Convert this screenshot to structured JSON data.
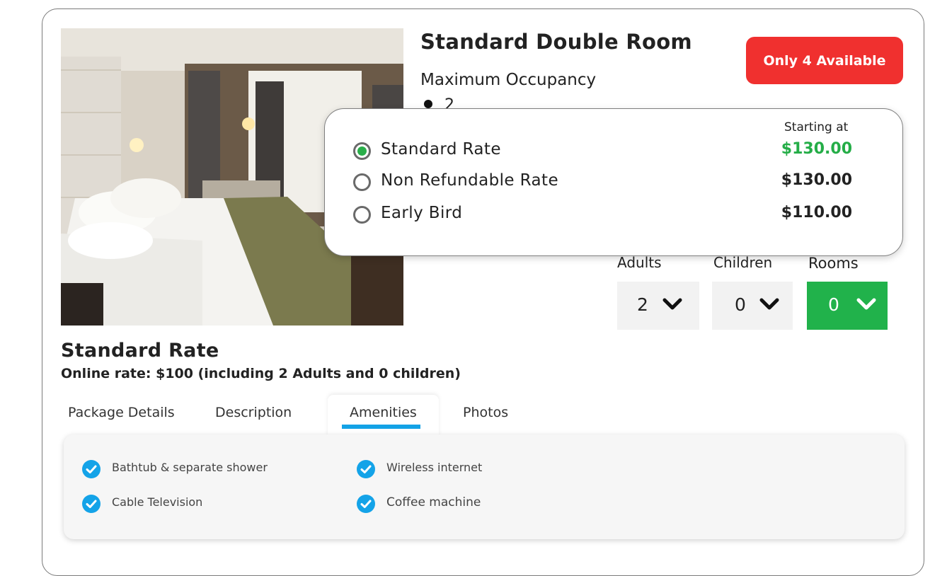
{
  "room": {
    "title": "Standard Double Room",
    "occupancy_label": "Maximum Occupancy",
    "occupancy_value": "2",
    "availability_badge": "Only 4 Available"
  },
  "rates_popup": {
    "starting_label": "Starting at",
    "rates": [
      {
        "name": "Standard Rate",
        "price": "$130.00",
        "selected": true
      },
      {
        "name": "Non Refundable Rate",
        "price": "$130.00",
        "selected": false
      },
      {
        "name": "Early Bird",
        "price": "$110.00",
        "selected": false
      }
    ]
  },
  "selectors": {
    "adults": {
      "label": "Adults",
      "value": "2"
    },
    "children": {
      "label": "Children",
      "value": "0"
    },
    "rooms": {
      "label": "Rooms",
      "value": "0"
    }
  },
  "rate_info": {
    "title": "Standard Rate",
    "description": "Online rate: $100 (including 2 Adults and 0 children)"
  },
  "tabs": [
    {
      "label": "Package Details",
      "active": false
    },
    {
      "label": "Description",
      "active": false
    },
    {
      "label": "Amenities",
      "active": true
    },
    {
      "label": "Photos",
      "active": false
    }
  ],
  "amenities": [
    "Bathtub & separate shower",
    "Wireless internet",
    "Cable Television",
    "Coffee machine"
  ],
  "colors": {
    "badge_red": "#f0302f",
    "price_green": "#24ad47",
    "rooms_green": "#21b24b",
    "tab_underline_blue": "#13a2e6",
    "check_blue": "#14a3e8"
  }
}
